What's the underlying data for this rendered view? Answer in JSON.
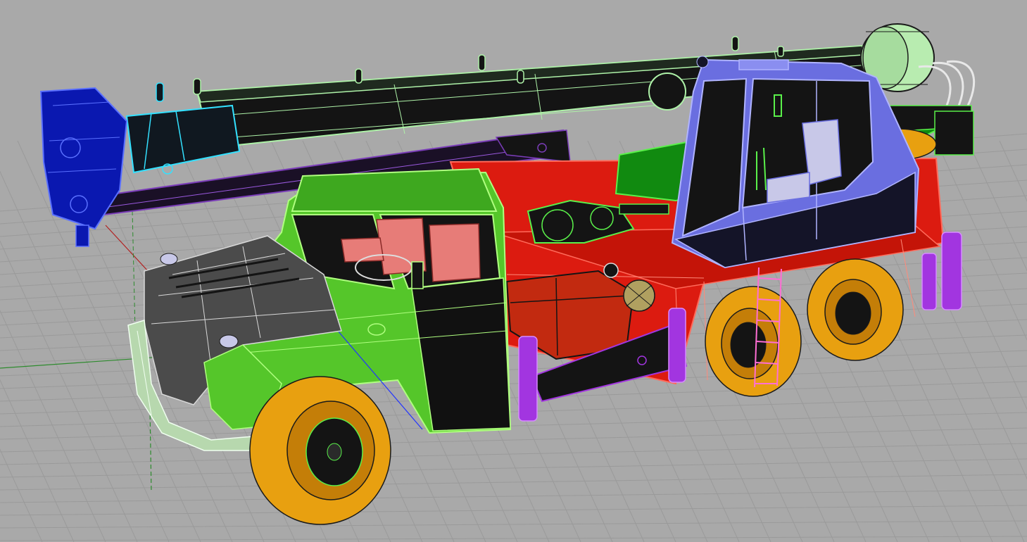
{
  "viewport": {
    "view": "perspective",
    "display_mode": "shaded-wireframe",
    "background": "#a9a9a9",
    "grid": true
  },
  "colors": {
    "grid_line": "#9a9a9a",
    "axis_x": "#b22222",
    "axis_y": "#2e8b2e",
    "boom_outer": "#aef2a8",
    "boom_inner": "#33e1ff",
    "boom_tip": "#1428d8",
    "boom_base": "#7a3db8",
    "truck_cab": "#55c62a",
    "truck_hood": "#4b4b4b",
    "truck_grille": "#b8b8b8",
    "truck_bumper": "#b7d8ae",
    "chassis": "#dc1b10",
    "operator_cab": "#6a6ee0",
    "turntable": "#2fb82a",
    "wheels": "#e8a010",
    "outriggers": "#a235e0",
    "ladder": "#ff6ed4",
    "seats": "#e77c78",
    "toolbox": "#c22a10",
    "winch": "#b8ecb0",
    "wire_edges": "#000000"
  },
  "model": {
    "parts": [
      {
        "name": "telescopic-boom",
        "color_key": "boom_outer"
      },
      {
        "name": "boom-inner-section",
        "color_key": "boom_inner"
      },
      {
        "name": "boom-tip-head",
        "color_key": "boom_tip"
      },
      {
        "name": "boom-base-section",
        "color_key": "boom_base"
      },
      {
        "name": "truck-cab",
        "color_key": "truck_cab"
      },
      {
        "name": "engine-hood",
        "color_key": "truck_hood"
      },
      {
        "name": "front-bumper",
        "color_key": "truck_bumper"
      },
      {
        "name": "chassis-frame",
        "color_key": "chassis"
      },
      {
        "name": "crane-operator-cab",
        "color_key": "operator_cab"
      },
      {
        "name": "turntable",
        "color_key": "turntable"
      },
      {
        "name": "wheels",
        "color_key": "wheels"
      },
      {
        "name": "outriggers",
        "color_key": "outriggers"
      },
      {
        "name": "access-ladder",
        "color_key": "ladder"
      },
      {
        "name": "cab-seats",
        "color_key": "seats"
      },
      {
        "name": "toolbox",
        "color_key": "toolbox"
      },
      {
        "name": "winch-drum",
        "color_key": "winch"
      }
    ]
  }
}
